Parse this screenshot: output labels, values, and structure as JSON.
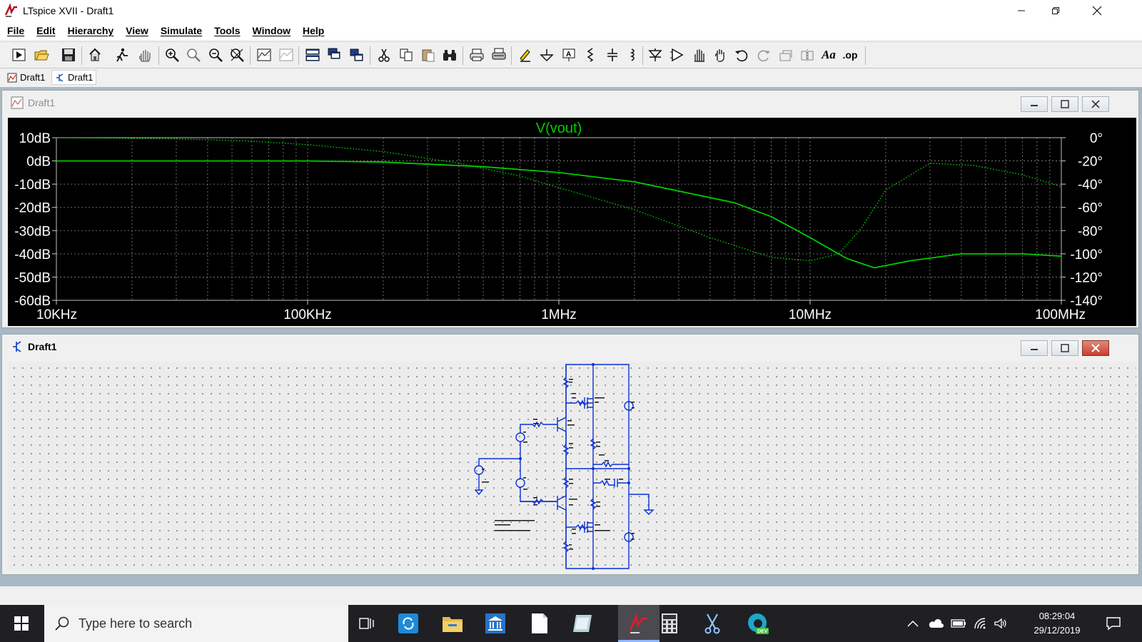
{
  "window": {
    "title": "LTspice XVII - Draft1",
    "controls": [
      "minimize",
      "maximize",
      "close"
    ]
  },
  "menu": [
    "File",
    "Edit",
    "Hierarchy",
    "View",
    "Simulate",
    "Tools",
    "Window",
    "Help"
  ],
  "toolbar": {
    "text_tool_label": "Aa",
    "spice_directive_label": ".op",
    "icons": [
      "run-icon",
      "open-icon",
      "save-icon",
      "control-panel-icon",
      "halt-icon",
      "pan-icon",
      "zoom-in-icon",
      "zoom-full-icon",
      "zoom-out-icon",
      "zoom-cancel-icon",
      "autorange-icon",
      "delete-traces-icon",
      "tile-horizontal-icon",
      "cascade-icon",
      "tile-vertical-icon",
      "cut-icon",
      "copy-icon",
      "paste-icon",
      "find-icon",
      "print-icon",
      "print-setup-icon",
      "wire-icon",
      "ground-icon",
      "label-net-icon",
      "resistor-icon",
      "capacitor-icon",
      "inductor-icon",
      "diode-icon",
      "component-icon",
      "move-icon",
      "drag-icon",
      "undo-icon",
      "redo-icon",
      "rotate-icon",
      "mirror-icon"
    ]
  },
  "tabs": [
    {
      "label": "Draft1",
      "kind": "waveform"
    },
    {
      "label": "Draft1",
      "kind": "schematic",
      "active": true
    }
  ],
  "waveform_window": {
    "title": "Draft1",
    "trace_label": "V(vout)",
    "trace_color": "#00cc00"
  },
  "schematic_window": {
    "title": "Draft1"
  },
  "chart_data": {
    "type": "line",
    "title": "V(vout)",
    "x_scale": "log",
    "xlim": [
      10000,
      100000000
    ],
    "x_tick_labels": [
      "10KHz",
      "100KHz",
      "1MHz",
      "10MHz",
      "100MHz"
    ],
    "x_ticks": [
      10000,
      100000,
      1000000,
      10000000,
      100000000
    ],
    "y_left_tick_labels": [
      "10dB",
      "0dB",
      "-10dB",
      "-20dB",
      "-30dB",
      "-40dB",
      "-50dB",
      "-60dB"
    ],
    "y_left_ticks": [
      10,
      0,
      -10,
      -20,
      -30,
      -40,
      -50,
      -60
    ],
    "ylim_left": [
      -60,
      10
    ],
    "y_right_tick_labels": [
      "0°",
      "-20°",
      "-40°",
      "-60°",
      "-80°",
      "-100°",
      "-120°",
      "-140°"
    ],
    "y_right_ticks": [
      0,
      -20,
      -40,
      -60,
      -80,
      -100,
      -120,
      -140
    ],
    "ylim_right": [
      -140,
      0
    ],
    "grid": true,
    "series": [
      {
        "name": "V(vout)",
        "style": "solid",
        "axis": "left",
        "x": [
          10000,
          30000,
          100000,
          200000,
          500000,
          1000000,
          2000000,
          5000000,
          7000000,
          10000000,
          14000000,
          18000000,
          25000000,
          40000000,
          70000000,
          100000000
        ],
        "y": [
          0,
          0,
          0,
          -0.5,
          -2.5,
          -5,
          -9,
          -18,
          -24,
          -33,
          -42,
          -46,
          -43,
          -40,
          -40,
          -41
        ]
      },
      {
        "name": "V(vout)",
        "style": "dotted",
        "axis": "right",
        "x": [
          10000,
          30000,
          60000,
          100000,
          200000,
          400000,
          700000,
          1000000,
          2000000,
          4000000,
          7000000,
          10000000,
          13000000,
          16000000,
          20000000,
          30000000,
          45000000,
          70000000,
          100000000
        ],
        "y": [
          0,
          -1,
          -3,
          -6,
          -12,
          -22,
          -33,
          -43,
          -62,
          -86,
          -103,
          -106,
          -100,
          -78,
          -45,
          -22,
          -24,
          -32,
          -42
        ]
      }
    ]
  },
  "taskbar": {
    "search_placeholder": "Type here to search",
    "time": "08:29:04",
    "date": "29/12/2019"
  }
}
